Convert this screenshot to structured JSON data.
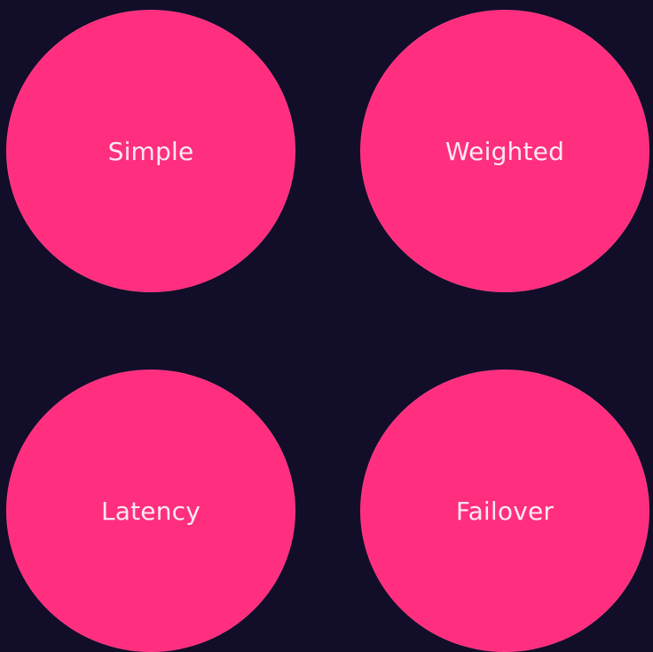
{
  "colors": {
    "background": "#120e2a",
    "circle_fill": "#ff2e7e",
    "label_text": "#fbe9f1"
  },
  "circles": [
    {
      "label": "Simple"
    },
    {
      "label": "Weighted"
    },
    {
      "label": "Latency"
    },
    {
      "label": "Failover"
    }
  ]
}
